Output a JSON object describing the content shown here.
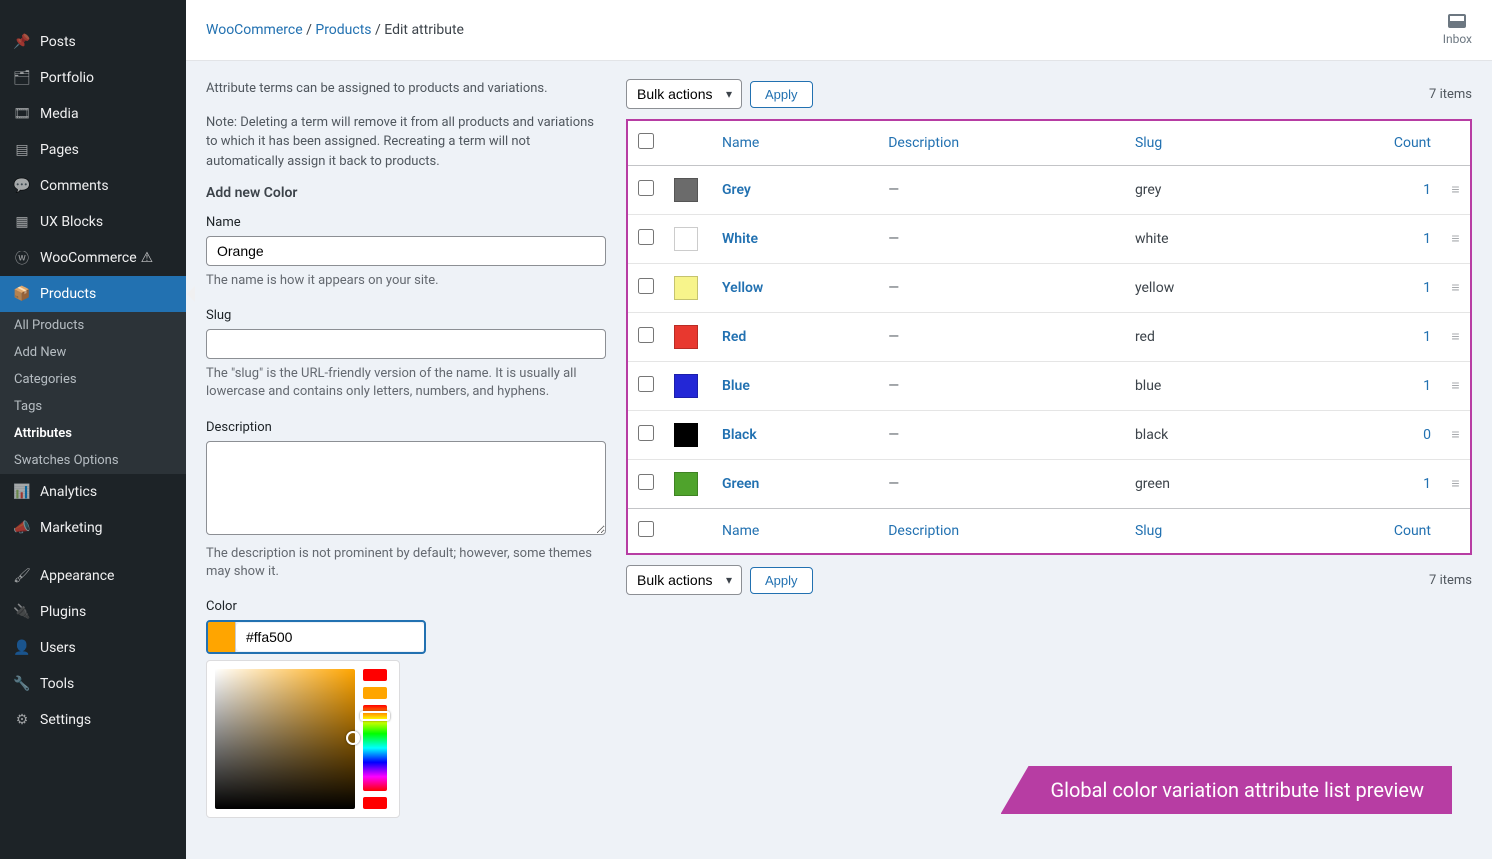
{
  "sidebar": {
    "items": [
      {
        "label": "Posts",
        "icon": "pin"
      },
      {
        "label": "Portfolio",
        "icon": "folder"
      },
      {
        "label": "Media",
        "icon": "media"
      },
      {
        "label": "Pages",
        "icon": "page"
      },
      {
        "label": "Comments",
        "icon": "comment"
      },
      {
        "label": "UX Blocks",
        "icon": "blocks"
      },
      {
        "label": "WooCommerce",
        "icon": "woo",
        "warn": true
      },
      {
        "label": "Products",
        "icon": "box",
        "active": true
      },
      {
        "label": "Analytics",
        "icon": "chart"
      },
      {
        "label": "Marketing",
        "icon": "megaphone"
      },
      {
        "label": "Appearance",
        "icon": "brush"
      },
      {
        "label": "Plugins",
        "icon": "plug"
      },
      {
        "label": "Users",
        "icon": "user"
      },
      {
        "label": "Tools",
        "icon": "wrench"
      },
      {
        "label": "Settings",
        "icon": "gear"
      }
    ],
    "products_sub": [
      {
        "label": "All Products"
      },
      {
        "label": "Add New"
      },
      {
        "label": "Categories"
      },
      {
        "label": "Tags"
      },
      {
        "label": "Attributes",
        "active": true
      },
      {
        "label": "Swatches Options"
      }
    ]
  },
  "breadcrumb": {
    "l1": "WooCommerce",
    "l2": "Products",
    "l3": "Edit attribute"
  },
  "inbox_label": "Inbox",
  "left": {
    "intro1": "Attribute terms can be assigned to products and variations.",
    "intro2": "Note: Deleting a term will remove it from all products and variations to which it has been assigned. Recreating a term will not automatically assign it back to products.",
    "heading": "Add new Color",
    "name_label": "Name",
    "name_value": "Orange",
    "name_hint": "The name is how it appears on your site.",
    "slug_label": "Slug",
    "slug_value": "",
    "slug_hint": "The \"slug\" is the URL-friendly version of the name. It is usually all lowercase and contains only letters, numbers, and hyphens.",
    "desc_label": "Description",
    "desc_value": "",
    "desc_hint": "The description is not prominent by default; however, some themes may show it.",
    "color_label": "Color",
    "color_value": "#ffa500"
  },
  "table": {
    "bulk_label": "Bulk actions",
    "apply_label": "Apply",
    "items_count": "7 items",
    "cols": {
      "name": "Name",
      "desc": "Description",
      "slug": "Slug",
      "count": "Count"
    },
    "rows": [
      {
        "name": "Grey",
        "desc": "—",
        "slug": "grey",
        "count": "1",
        "swatch": "#6b6b6b"
      },
      {
        "name": "White",
        "desc": "—",
        "slug": "white",
        "count": "1",
        "swatch": "#ffffff"
      },
      {
        "name": "Yellow",
        "desc": "—",
        "slug": "yellow",
        "count": "1",
        "swatch": "#f7f48b"
      },
      {
        "name": "Red",
        "desc": "—",
        "slug": "red",
        "count": "1",
        "swatch": "#e8382f"
      },
      {
        "name": "Blue",
        "desc": "—",
        "slug": "blue",
        "count": "1",
        "swatch": "#2327d6"
      },
      {
        "name": "Black",
        "desc": "—",
        "slug": "black",
        "count": "0",
        "swatch": "#000000"
      },
      {
        "name": "Green",
        "desc": "—",
        "slug": "green",
        "count": "1",
        "swatch": "#4fa32c"
      }
    ]
  },
  "banner": "Global color variation attribute list preview"
}
